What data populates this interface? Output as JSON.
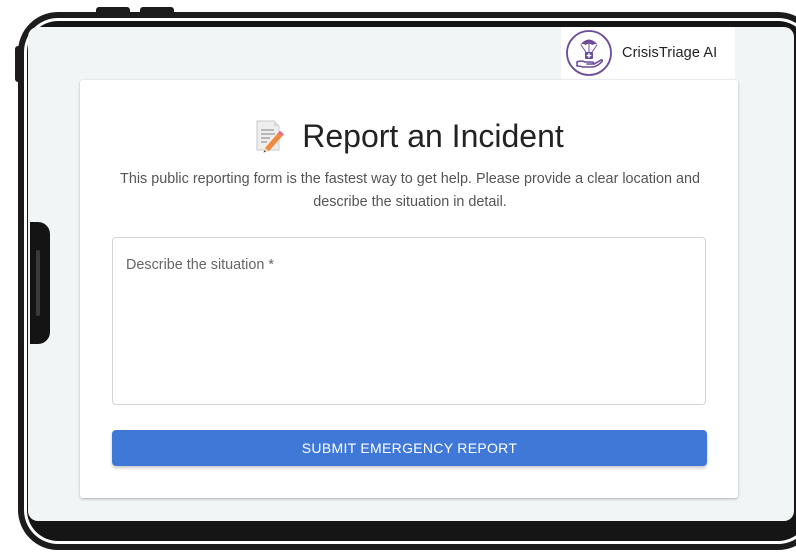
{
  "brand": {
    "name": "CrisisTriage AI",
    "logo_icon": "parachute-hand-icon",
    "accent_color": "#6b4c9a"
  },
  "form": {
    "title": "Report an Incident",
    "title_icon": "memo-pencil-icon",
    "description": "This public reporting form is the fastest way to get help. Please provide a clear location and describe the situation in detail.",
    "situation_field": {
      "label": "Describe the situation *",
      "value": ""
    },
    "submit_label": "SUBMIT EMERGENCY REPORT",
    "submit_color": "#3f78d6"
  }
}
